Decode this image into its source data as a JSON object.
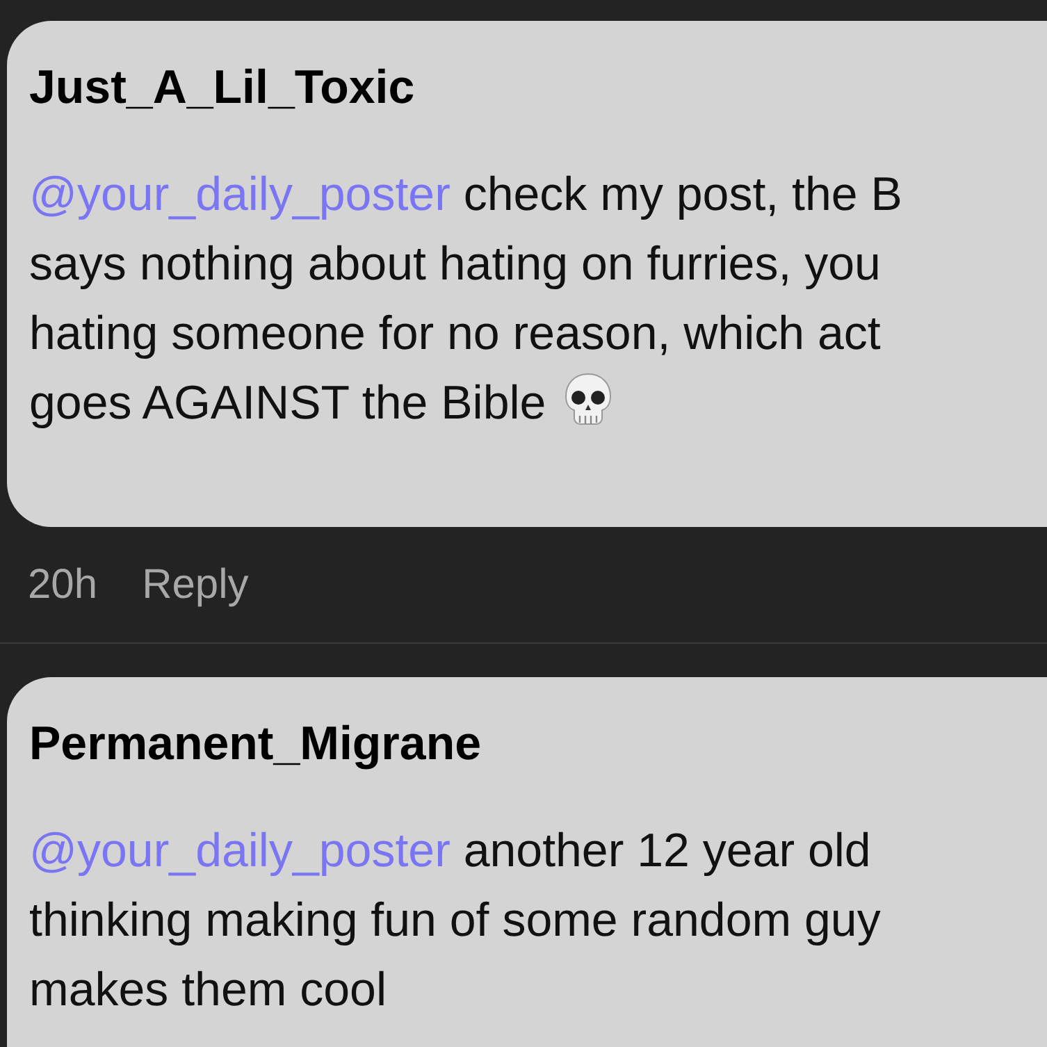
{
  "comments": [
    {
      "author": "Just_A_Lil_Toxic",
      "mention": "@your_daily_poster",
      "lines": [
        " check my post, the B",
        "says nothing about hating on furries, you",
        "hating someone for no reason, which act",
        "goes AGAINST the Bible"
      ],
      "skull": true,
      "time": "20h",
      "reply": "Reply"
    },
    {
      "author": "Permanent_Migrane",
      "mention": "@your_daily_poster",
      "lines": [
        " another 12 year old",
        "thinking making fun of some random guy",
        "makes them cool"
      ],
      "skull": false
    }
  ]
}
